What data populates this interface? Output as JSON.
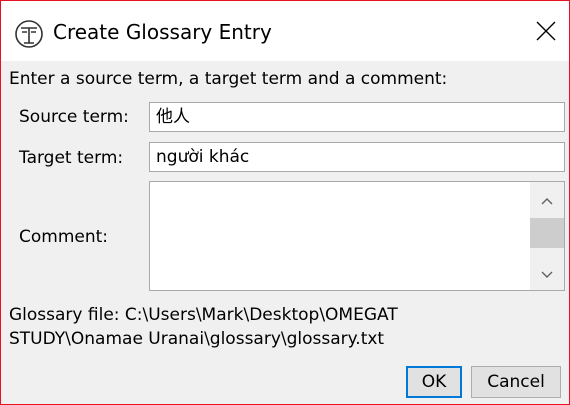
{
  "window": {
    "title": "Create Glossary Entry",
    "accent_border": "#e81123"
  },
  "form": {
    "prompt": "Enter a source term, a target term and a comment:",
    "source_label": "Source term:",
    "source_value": "他人",
    "target_label": "Target term:",
    "target_value": "người khác",
    "comment_label": "Comment:",
    "comment_value": ""
  },
  "glossary": {
    "line1": "Glossary file: C:\\Users\\Mark\\Desktop\\OMEGAT",
    "line2": "STUDY\\Onamae Uranai\\glossary\\glossary.txt"
  },
  "buttons": {
    "ok": "OK",
    "cancel": "Cancel"
  },
  "icons": {
    "app": "omegat-app-icon",
    "close": "close-icon",
    "scroll_up": "chevron-up-icon",
    "scroll_down": "chevron-down-icon"
  },
  "colors": {
    "focus": "#0078d7",
    "dialog_bg": "#f0f0f0"
  }
}
